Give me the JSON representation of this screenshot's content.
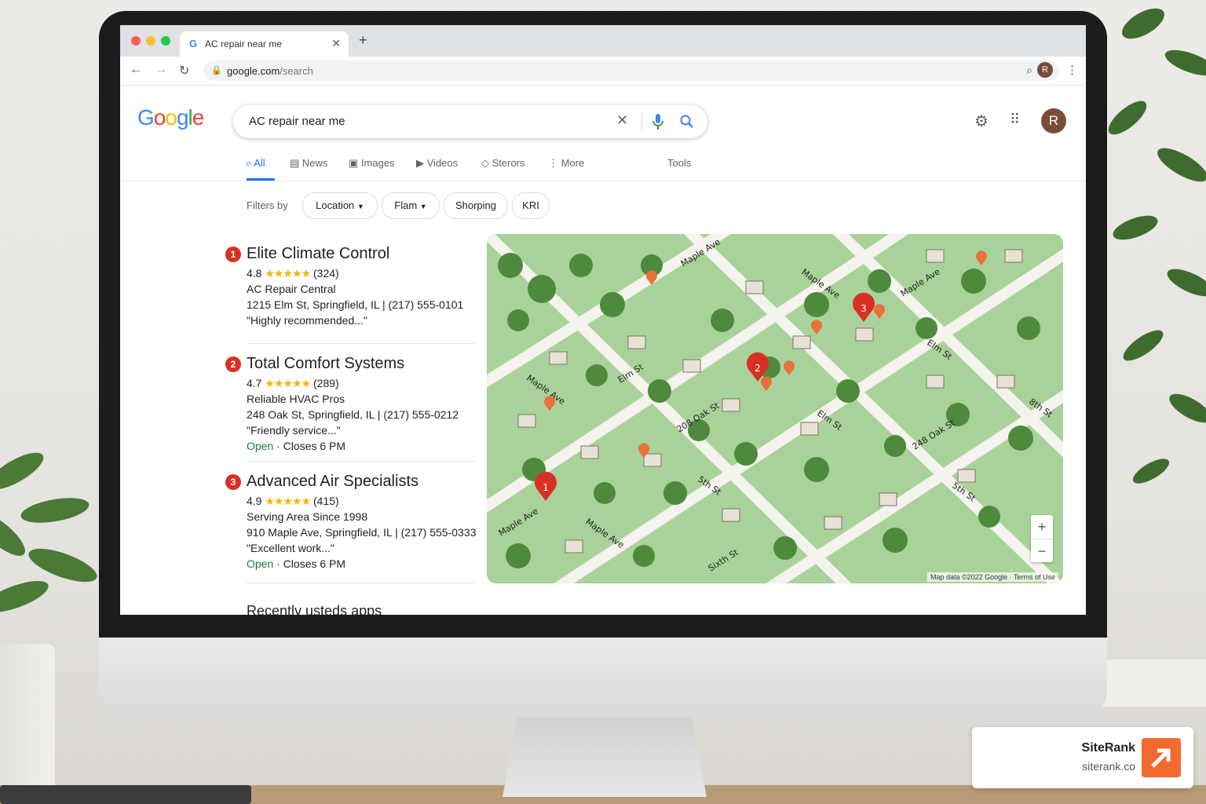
{
  "browser": {
    "tab_title": "AC repair near me",
    "url_host": "google.com",
    "url_path": "/search",
    "profile_initial": "R"
  },
  "google": {
    "logo": "Google",
    "query": "AC repair near me",
    "tabs": [
      "All",
      "News",
      "Images",
      "Videos",
      "Sterors",
      "More",
      "Tools"
    ],
    "filters_label": "Filters by",
    "chips": [
      "Location",
      "Flam",
      "Shorping",
      "KRI"
    ],
    "profile_initial": "R"
  },
  "results": [
    {
      "num": "1",
      "name": "Elite Climate Control",
      "rating": "4.8",
      "stars": "★★★★★",
      "reviews": "(324)",
      "line1": "AC Repair Central",
      "line2": "1215 Elm St, Springfield, IL | (217) 555-0101",
      "line3": "\"Highly recommended...\""
    },
    {
      "num": "2",
      "name": "Total Comfort Systems",
      "rating": "4.7",
      "stars": "★★★★★",
      "reviews": "(289)",
      "line1": "Reliable HVAC Pros",
      "line2": "248 Oak St, Springfield, IL | (217) 555-0212",
      "line3": "\"Friendly service...\"",
      "open": "Open",
      "hours": "· Closes 6 PM"
    },
    {
      "num": "3",
      "name": "Advanced Air Specialists",
      "rating": "4.9",
      "stars": "★★★★★",
      "reviews": "(415)",
      "line1": "Serving Area Since 1998",
      "line2": "910 Maple Ave, Springfield, IL | (217) 555-0333",
      "line3": "\"Excellent work...\"",
      "open": "Open",
      "hours": "· Closes 6 PM"
    }
  ],
  "cutoff_text": "Recently usteds apps",
  "map": {
    "streets": [
      "Maple Ave",
      "Maple Ave",
      "Maple Ave",
      "Elm St",
      "Elm St",
      "Elm St",
      "208 Oak St",
      "248 Oak St",
      "5th St",
      "5th St",
      "Maple Ave",
      "Maple Ave",
      "Maple Ave",
      "Sixth St",
      "8th St"
    ],
    "pins": [
      "1",
      "2",
      "3"
    ],
    "zoom_in": "+",
    "zoom_out": "−",
    "attribution": "Map data ©2022 Google · Terms of Use"
  },
  "branding": {
    "name": "SiteRank",
    "site": "siterank.co",
    "color": "#f26a2e"
  }
}
